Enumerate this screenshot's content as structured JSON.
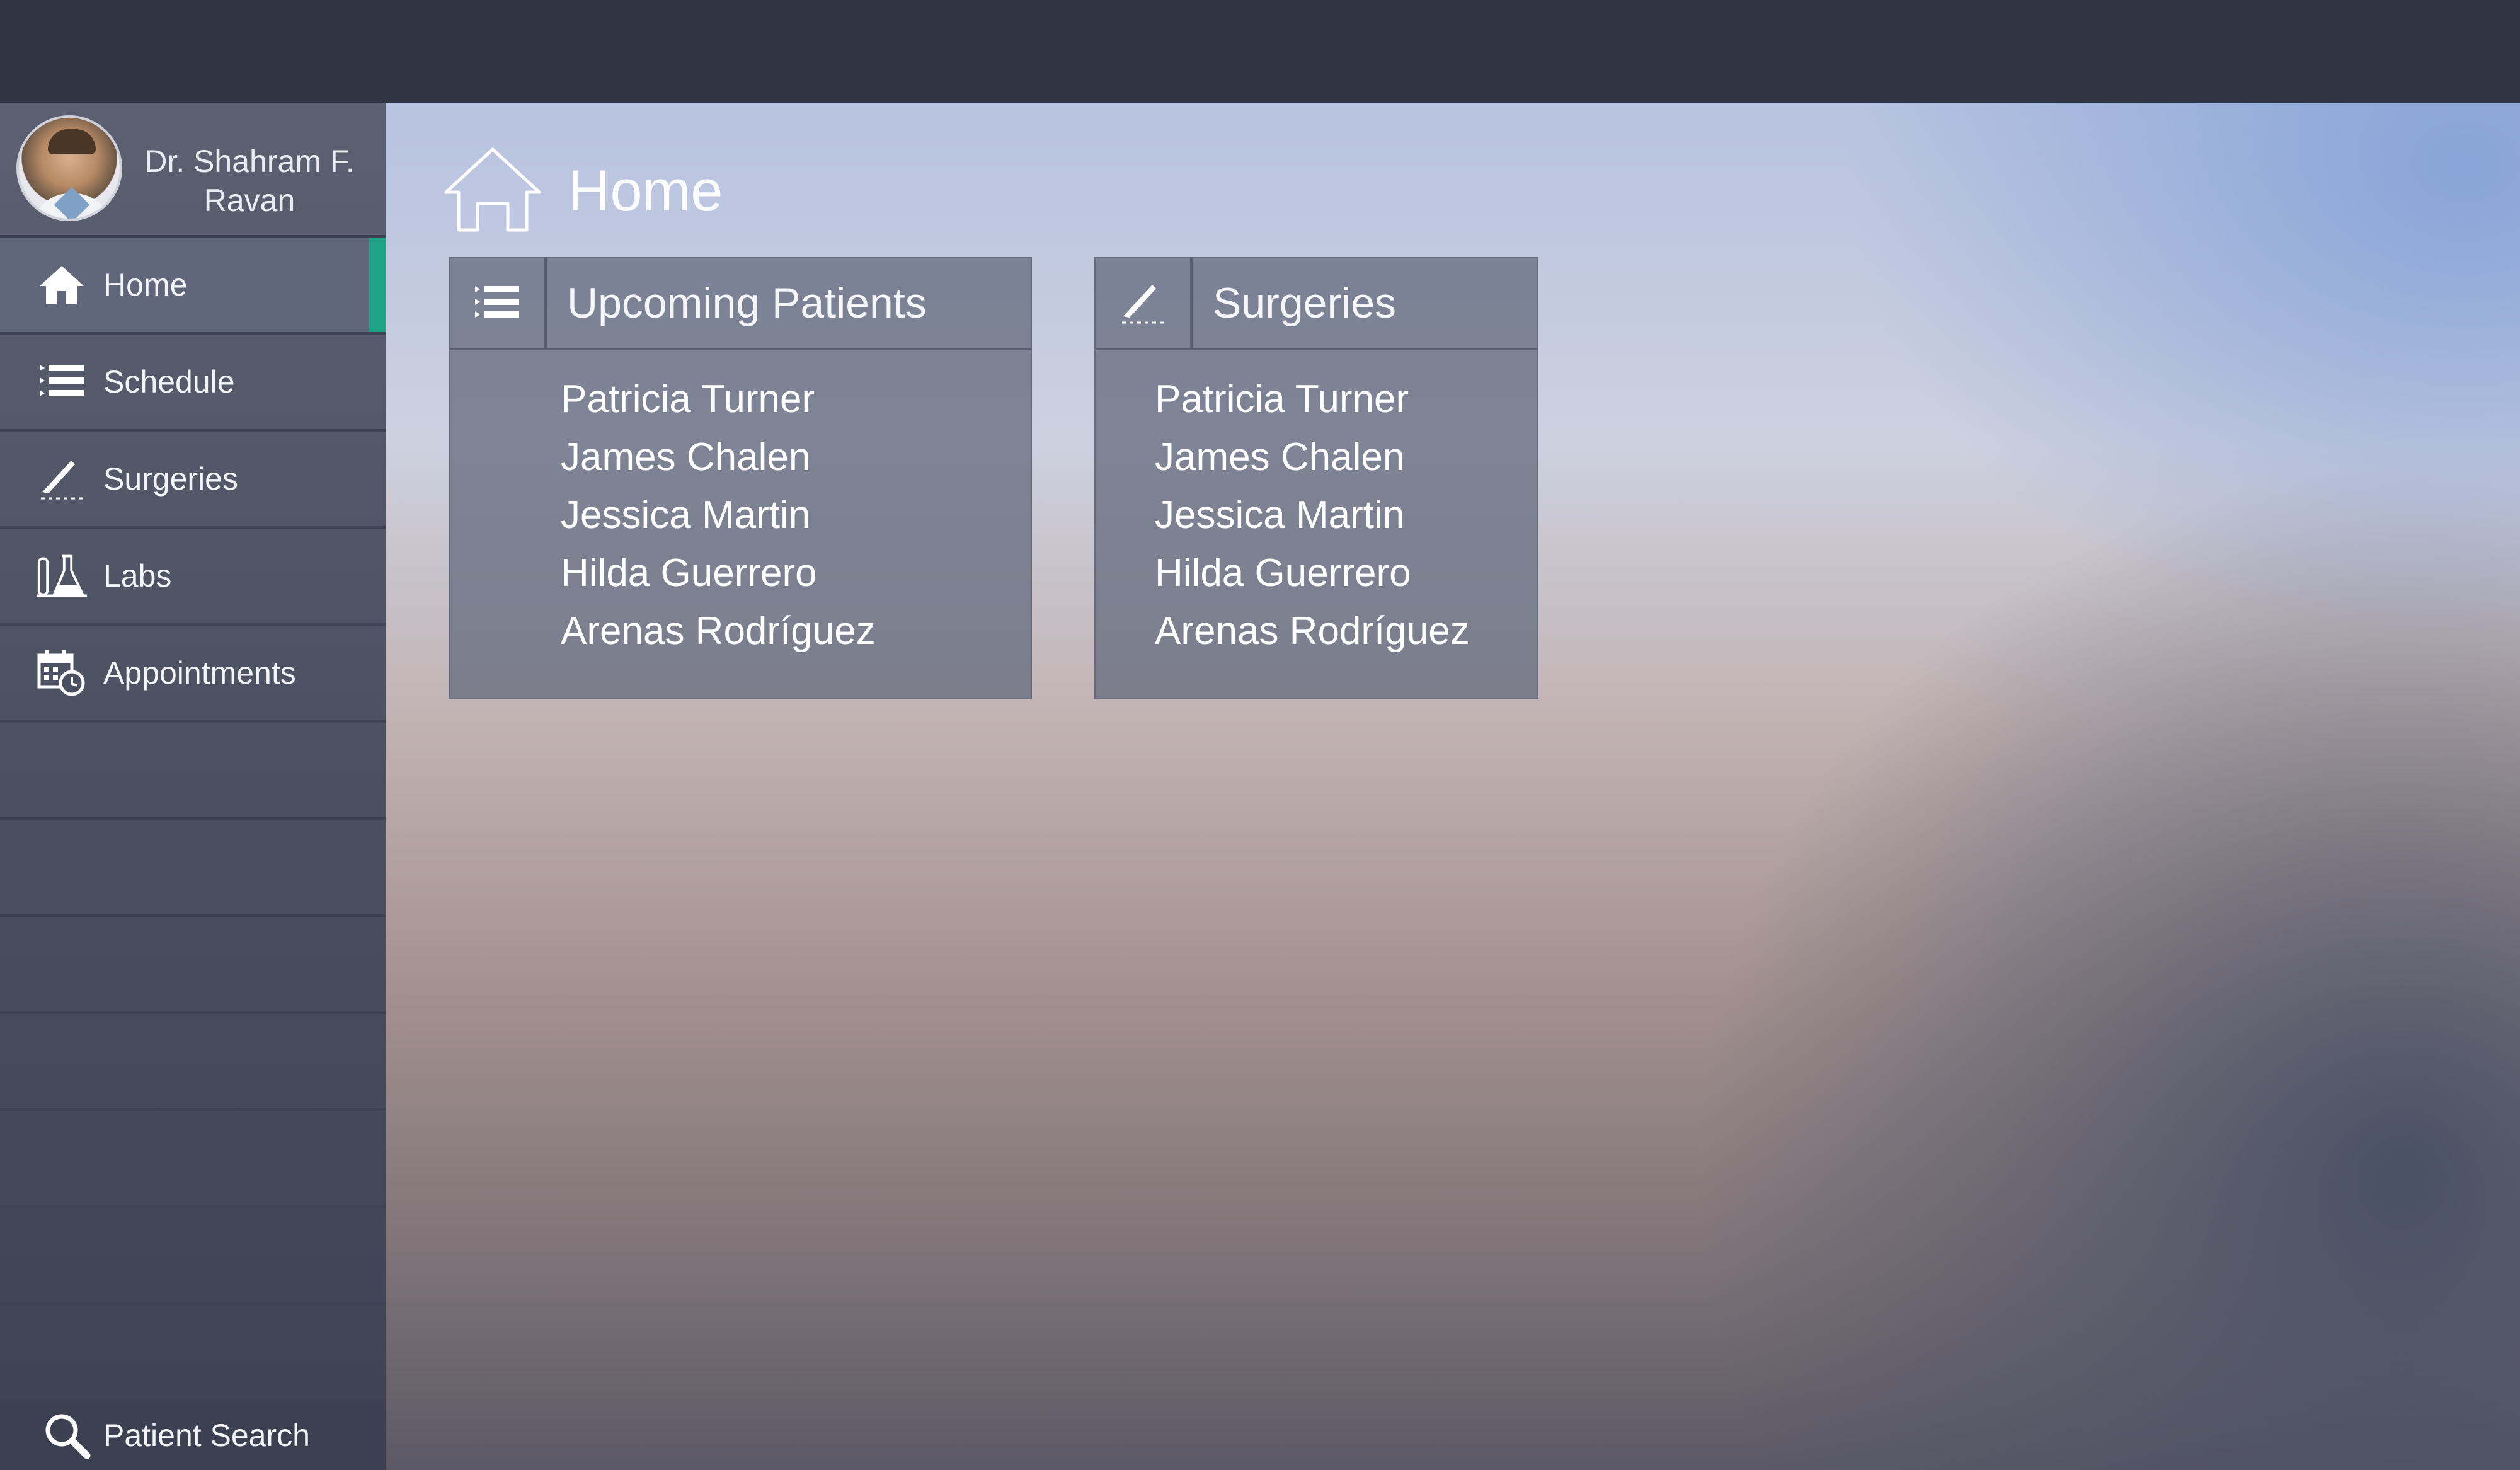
{
  "user": {
    "name": "Dr. Shahram F. Ravan",
    "avatar_icon": "doctor-avatar"
  },
  "nav": {
    "items": [
      {
        "label": "Home",
        "icon": "home-icon",
        "active": true
      },
      {
        "label": "Schedule",
        "icon": "list-icon",
        "active": false
      },
      {
        "label": "Surgeries",
        "icon": "scalpel-icon",
        "active": false
      },
      {
        "label": "Labs",
        "icon": "flask-icon",
        "active": false
      },
      {
        "label": "Appointments",
        "icon": "calendar-icon",
        "active": false
      }
    ],
    "search_label": "Patient Search",
    "search_icon": "search-icon"
  },
  "colors": {
    "accent": "#1fa387",
    "topbar": "#2f3542",
    "sidebar": "#4b5061"
  },
  "page": {
    "title": "Home",
    "icon": "home-outline-icon"
  },
  "cards": {
    "upcoming": {
      "title": "Upcoming Patients",
      "icon": "list-icon",
      "patients": [
        "Patricia Turner",
        "James Chalen",
        "Jessica Martin",
        "Hilda Guerrero",
        "Arenas Rodríguez"
      ]
    },
    "surgeries": {
      "title": "Surgeries",
      "icon": "scalpel-icon",
      "patients": [
        "Patricia Turner",
        "James Chalen",
        "Jessica Martin",
        "Hilda Guerrero",
        "Arenas Rodríguez"
      ]
    }
  }
}
